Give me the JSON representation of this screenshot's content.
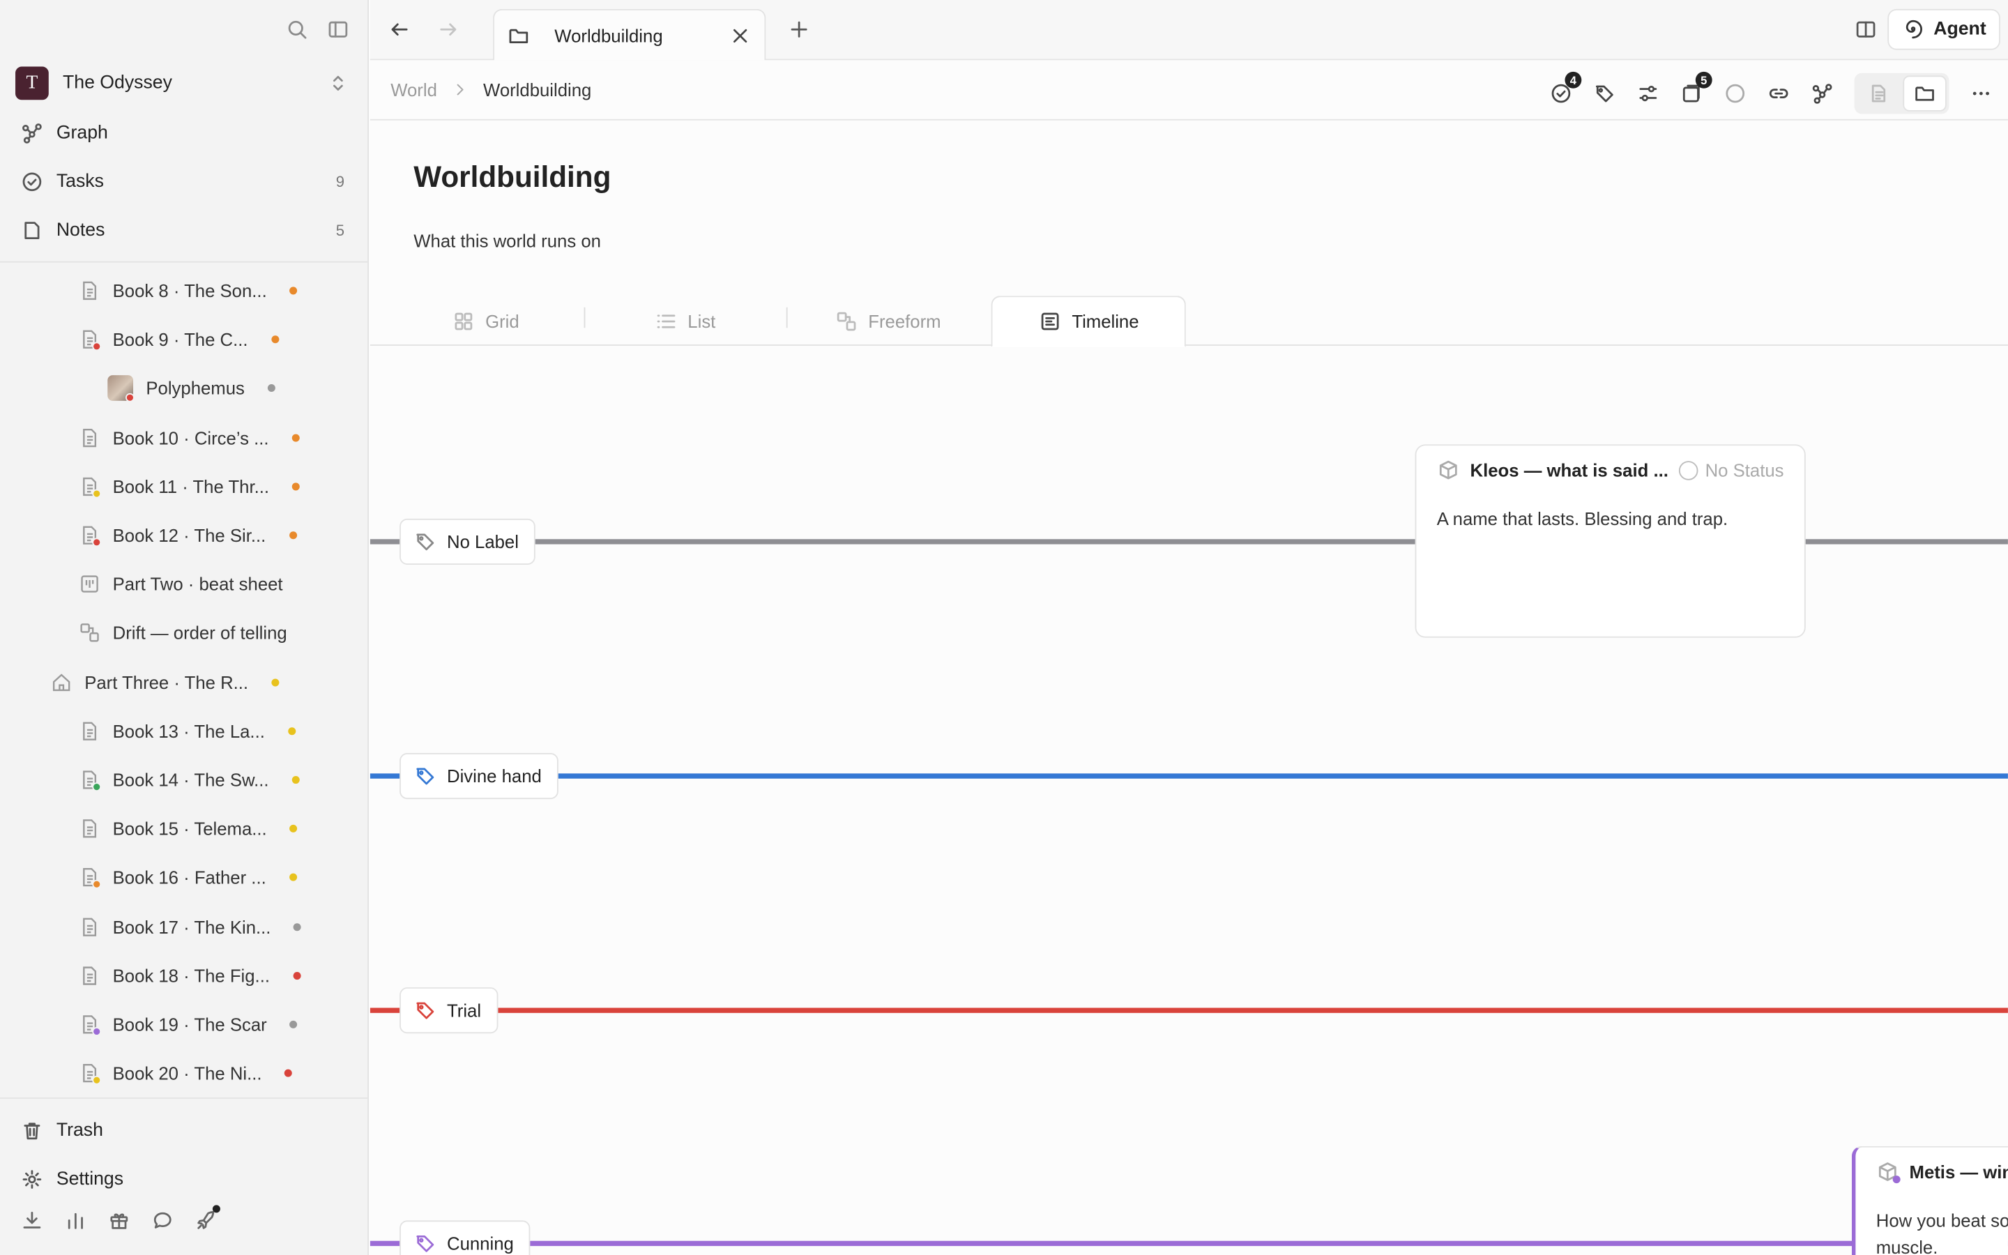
{
  "workspace": {
    "initial": "T",
    "name": "The Odyssey"
  },
  "nav": {
    "graph": "Graph",
    "tasks": {
      "label": "Tasks",
      "count": "9"
    },
    "notes": {
      "label": "Notes",
      "count": "5"
    }
  },
  "tree": [
    {
      "label": "Book 8 · The Son...",
      "status_color": "#e8892b",
      "badge": ""
    },
    {
      "label": "Book 9 · The C...",
      "status_color": "#e8892b",
      "badge": "#d9433b"
    },
    {
      "label": "Polyphemus",
      "status_color": "#999999",
      "badge": "#d9433b"
    },
    {
      "label": "Book 10 · Circe’s ...",
      "status_color": "#e8892b",
      "badge": ""
    },
    {
      "label": "Book 11 · The Thr...",
      "status_color": "#e8892b",
      "badge": "#e8c21d"
    },
    {
      "label": "Book 12 · The Sir...",
      "status_color": "#e8892b",
      "badge": "#d9433b"
    },
    {
      "label": "Part Two · beat sheet",
      "status_color": "",
      "badge": ""
    },
    {
      "label": "Drift — order of telling",
      "status_color": "",
      "badge": ""
    },
    {
      "label": "Part Three · The R...",
      "status_color": "#e8c21d",
      "badge": ""
    },
    {
      "label": "Book 13 · The La...",
      "status_color": "#e8c21d",
      "badge": ""
    },
    {
      "label": "Book 14 · The Sw...",
      "status_color": "#e8c21d",
      "badge": "#3aa55a"
    },
    {
      "label": "Book 15 · Telema...",
      "status_color": "#e8c21d",
      "badge": ""
    },
    {
      "label": "Book 16 · Father ...",
      "status_color": "#e8c21d",
      "badge": "#e8892b"
    },
    {
      "label": "Book 17 · The Kin...",
      "status_color": "#999999",
      "badge": ""
    },
    {
      "label": "Book 18 · The Fig...",
      "status_color": "#d9433b",
      "badge": ""
    },
    {
      "label": "Book 19 · The Scar",
      "status_color": "#999999",
      "badge": "#9b6bd6"
    },
    {
      "label": "Book 20 · The Ni...",
      "status_color": "#d9433b",
      "badge": "#e8c21d"
    }
  ],
  "footer": {
    "trash": "Trash",
    "settings": "Settings"
  },
  "tab": {
    "title": "Worldbuilding"
  },
  "agent_label": "Agent",
  "breadcrumb": {
    "parent": "World",
    "current": "Worldbuilding"
  },
  "toolbar": {
    "tasks_badge": "4",
    "cards_badge": "5"
  },
  "page": {
    "title": "Worldbuilding",
    "subtitle": "What this world runs on"
  },
  "views": {
    "grid": "Grid",
    "list": "List",
    "freeform": "Freeform",
    "timeline": "Timeline"
  },
  "lanes": [
    {
      "label": "No Label",
      "color": "#8e8e93"
    },
    {
      "label": "Divine hand",
      "color": "#3478d4"
    },
    {
      "label": "Trial",
      "color": "#d9433b"
    },
    {
      "label": "Cunning",
      "color": "#9b6bd6"
    }
  ],
  "cards": [
    {
      "title": "Kleos — what is said ...",
      "status": "No Status",
      "body": "A name that lasts. Blessing and trap."
    },
    {
      "title": "Metis — winn",
      "body": "How you beat so muscle."
    }
  ]
}
